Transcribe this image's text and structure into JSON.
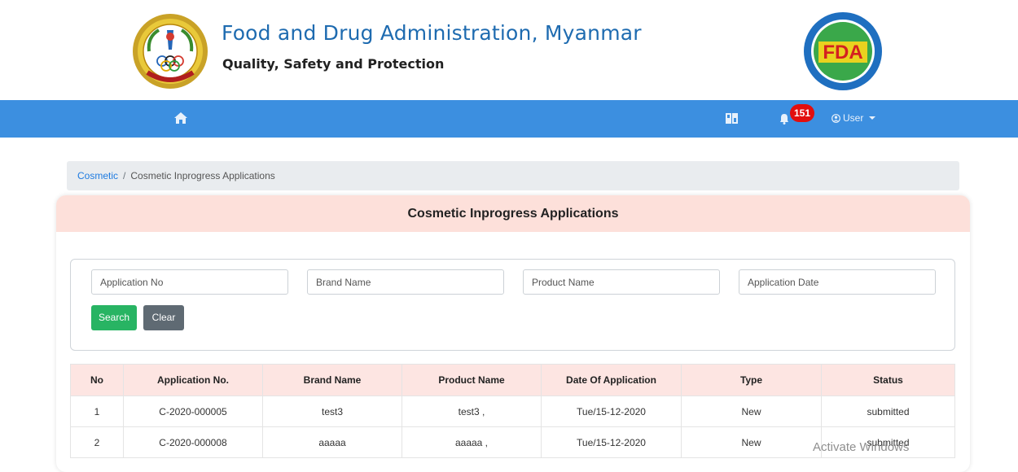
{
  "header": {
    "title": "Food and Drug Administration, Myanmar",
    "subtitle": "Quality, Safety and Protection",
    "logo_right_text": "FDA"
  },
  "navbar": {
    "home_icon": "home-icon",
    "map_icon": "map-book-icon",
    "bell_icon": "bell-icon",
    "notification_count": "151",
    "user_label": "User"
  },
  "breadcrumb": {
    "parent": "Cosmetic",
    "separator": "/",
    "current": "Cosmetic Inprogress Applications"
  },
  "card": {
    "title": "Cosmetic Inprogress Applications"
  },
  "search": {
    "application_no_placeholder": "Application No",
    "brand_name_placeholder": "Brand Name",
    "product_name_placeholder": "Product Name",
    "application_date_placeholder": "Application Date",
    "search_label": "Search",
    "clear_label": "Clear"
  },
  "table": {
    "columns": [
      "No",
      "Application No.",
      "Brand Name",
      "Product Name",
      "Date Of Application",
      "Type",
      "Status"
    ],
    "rows": [
      [
        "1",
        "C-2020-000005",
        "test3",
        "test3 ,",
        "Tue/15-12-2020",
        "New",
        "submitted"
      ],
      [
        "2",
        "C-2020-000008",
        "aaaaa",
        "aaaaa ,",
        "Tue/15-12-2020",
        "New",
        "submitted"
      ]
    ]
  },
  "watermark": "Activate Windows",
  "colors": {
    "title_blue": "#1e6bb0",
    "navbar_blue": "#3c8fe0",
    "badge_red": "#e20e0e",
    "header_pink": "#fde0da",
    "search_green": "#28b463",
    "clear_gray": "#5f6a73"
  }
}
